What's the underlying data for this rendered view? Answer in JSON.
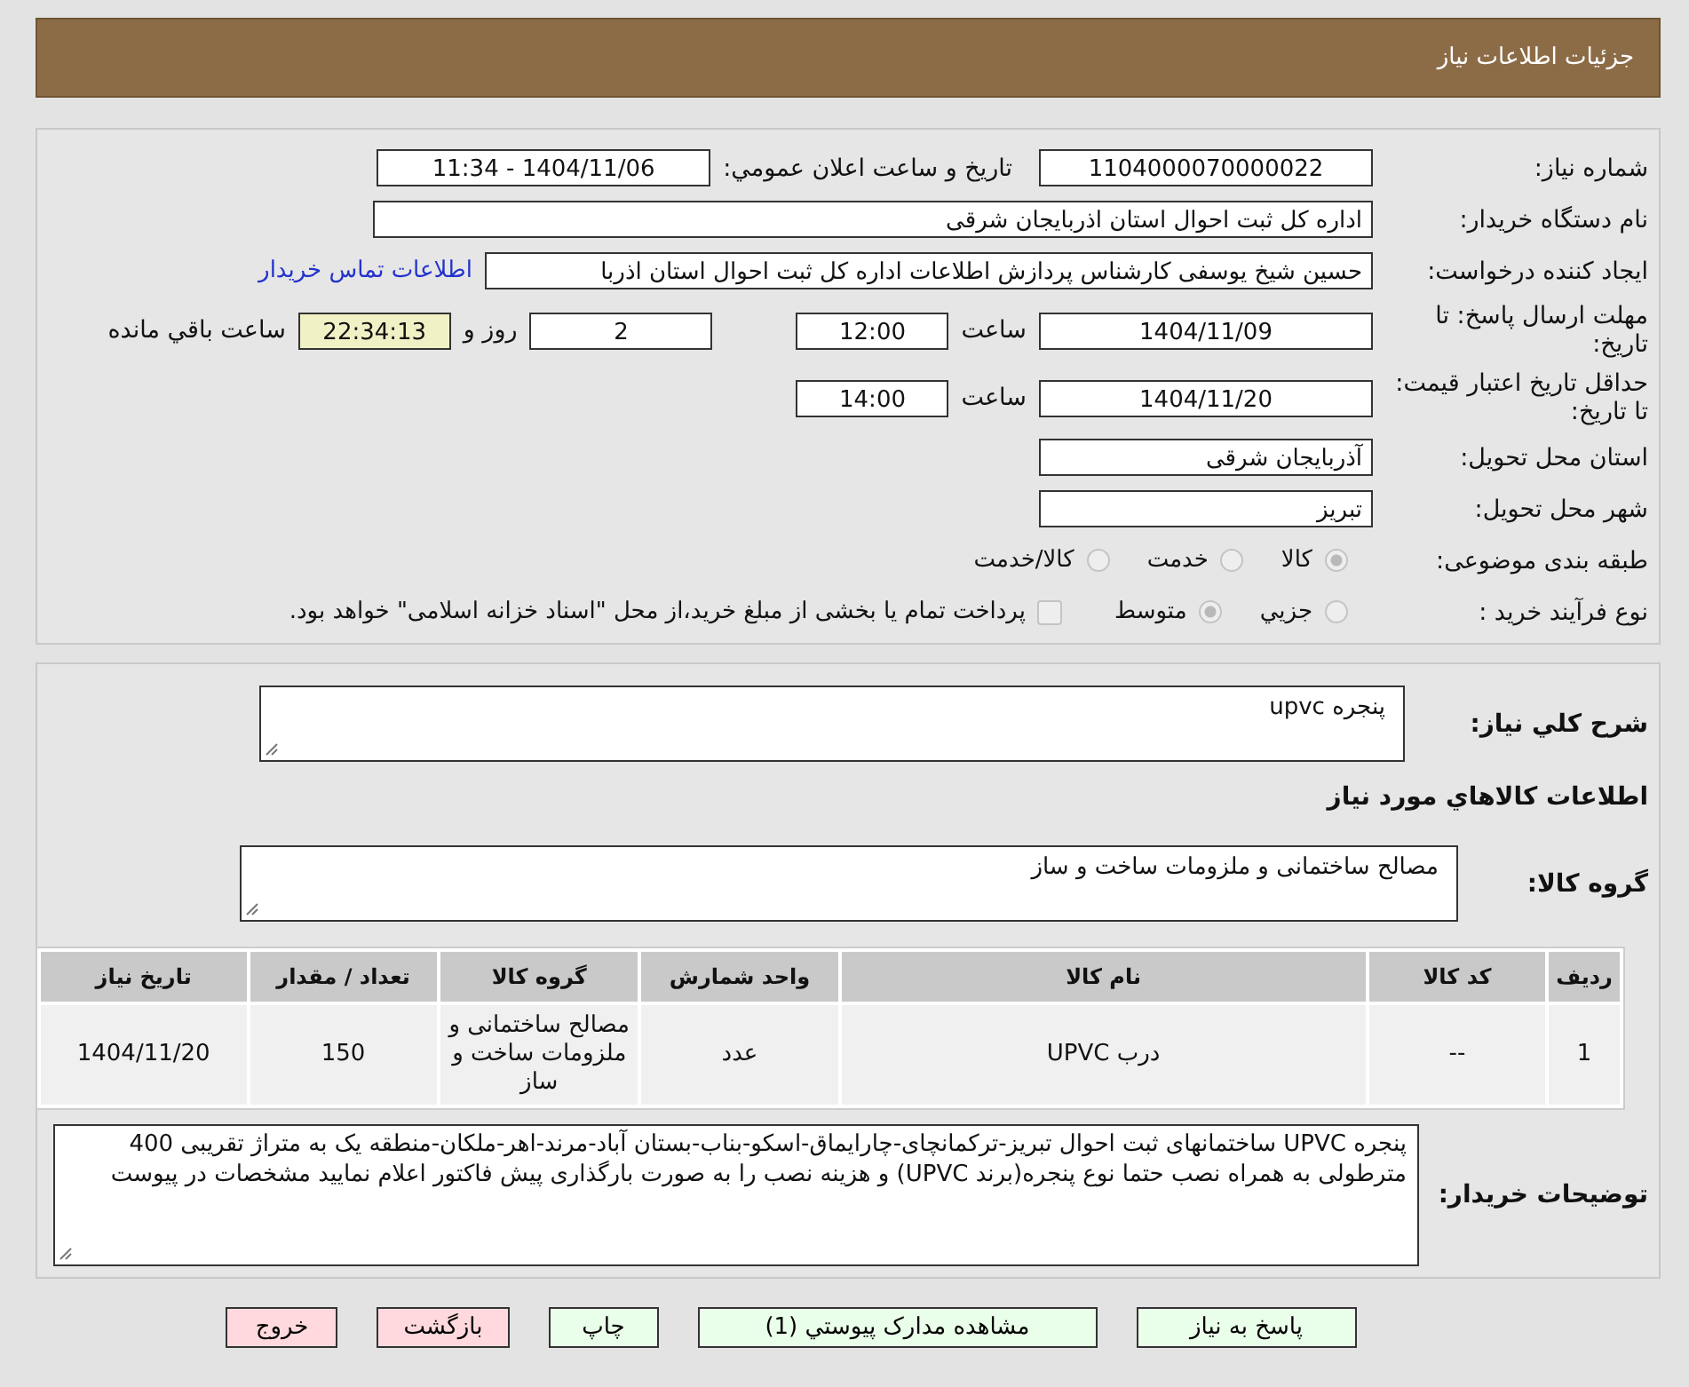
{
  "header": {
    "title": "جزئیات اطلاعات نیاز"
  },
  "need_number": {
    "label": "شماره نیاز:",
    "value": "1104000070000022"
  },
  "announce": {
    "label": "تاریخ و ساعت اعلان عمومي:",
    "value": "1404/11/06 - 11:34"
  },
  "buyer": {
    "label": "نام دستگاه خریدار:",
    "value": "اداره کل ثبت احوال استان اذربایجان شرقی"
  },
  "requester": {
    "label": "ایجاد کننده درخواست:",
    "value": "حسین شیخ یوسفی کارشناس پردازش اطلاعات اداره کل ثبت احوال استان اذربا",
    "link": "اطلاعات تماس خریدار"
  },
  "deadline": {
    "label": "مهلت ارسال پاسخ: تا تاریخ:",
    "date": "1404/11/09",
    "time_label": "ساعت",
    "time": "12:00",
    "days": "2",
    "days_label": "روز و",
    "remaining": "22:34:13",
    "remaining_label": "ساعت باقي مانده"
  },
  "validity": {
    "label": "حداقل تاریخ اعتبار قیمت: تا تاریخ:",
    "date": "1404/11/20",
    "time_label": "ساعت",
    "time": "14:00"
  },
  "province": {
    "label": "استان محل تحویل:",
    "value": "آذربایجان شرقی"
  },
  "city": {
    "label": "شهر محل تحویل:",
    "value": "تبریز"
  },
  "category": {
    "label": "طبقه بندی موضوعی:",
    "options": [
      {
        "label": "کالا",
        "selected": true
      },
      {
        "label": "خدمت",
        "selected": false
      },
      {
        "label": "کالا/خدمت",
        "selected": false
      }
    ]
  },
  "process": {
    "label": "نوع فرآیند خرید :",
    "options": [
      {
        "label": "جزيي",
        "selected": false
      },
      {
        "label": "متوسط",
        "selected": true
      }
    ],
    "treasury": {
      "checked": false,
      "label": "پرداخت تمام یا بخشی از مبلغ خرید،از محل \"اسناد خزانه اسلامی\" خواهد بود."
    }
  },
  "summary": {
    "label": "شرح کلي نیاز:",
    "value": "پنجره upvc"
  },
  "goods_heading": "اطلاعات کالاهاي مورد نیاز",
  "goods_group": {
    "label": "گروه کالا:",
    "value": "مصالح ساختمانی و ملزومات ساخت و ساز"
  },
  "table": {
    "columns": [
      "ردیف",
      "کد کالا",
      "نام کالا",
      "واحد شمارش",
      "گروه کالا",
      "تعداد / مقدار",
      "تاریخ نیاز"
    ],
    "rows": [
      [
        "1",
        "--",
        "درب UPVC",
        "عدد",
        "مصالح ساختمانی و ملزومات ساخت و ساز",
        "150",
        "1404/11/20"
      ]
    ]
  },
  "buyer_notes": {
    "label": "توضیحات خریدار:",
    "value": "پنجره UPVC ساختمانهای ثبت احوال تبریز-ترکمانچای-چارایماق-اسکو-بناب-بستان آباد-مرند-اهر-ملکان-منطقه یک به متراژ تقریبی 400 مترطولی به همراه نصب حتما نوع پنجره(برند UPVC) و هزینه نصب را به صورت بارگذاری پیش فاکتور اعلام نمایید مشخصات در پیوست"
  },
  "buttons": [
    {
      "label": "پاسخ به نیاز",
      "kind": "action"
    },
    {
      "label": "مشاهده مدارک پیوستي (1)",
      "kind": "action"
    },
    {
      "label": "چاپ",
      "kind": "action"
    },
    {
      "label": "بازگشت",
      "kind": "exit"
    },
    {
      "label": "خروج",
      "kind": "exit"
    }
  ]
}
